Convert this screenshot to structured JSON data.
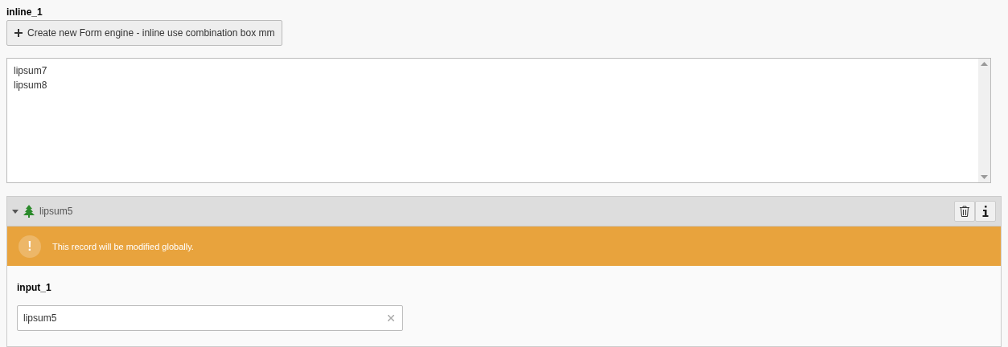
{
  "inline_field": {
    "label": "inline_1",
    "create_button": "Create new Form engine - inline use combination box mm",
    "select_items": [
      {
        "label": "lipsum7",
        "selected": false
      },
      {
        "label": "lipsum8",
        "selected": false
      }
    ]
  },
  "record": {
    "title": "lipsum5",
    "expanded": true,
    "alert": {
      "icon": "!",
      "message": "This record will be modified globally."
    },
    "field": {
      "label": "input_1",
      "value": "lipsum5"
    }
  }
}
